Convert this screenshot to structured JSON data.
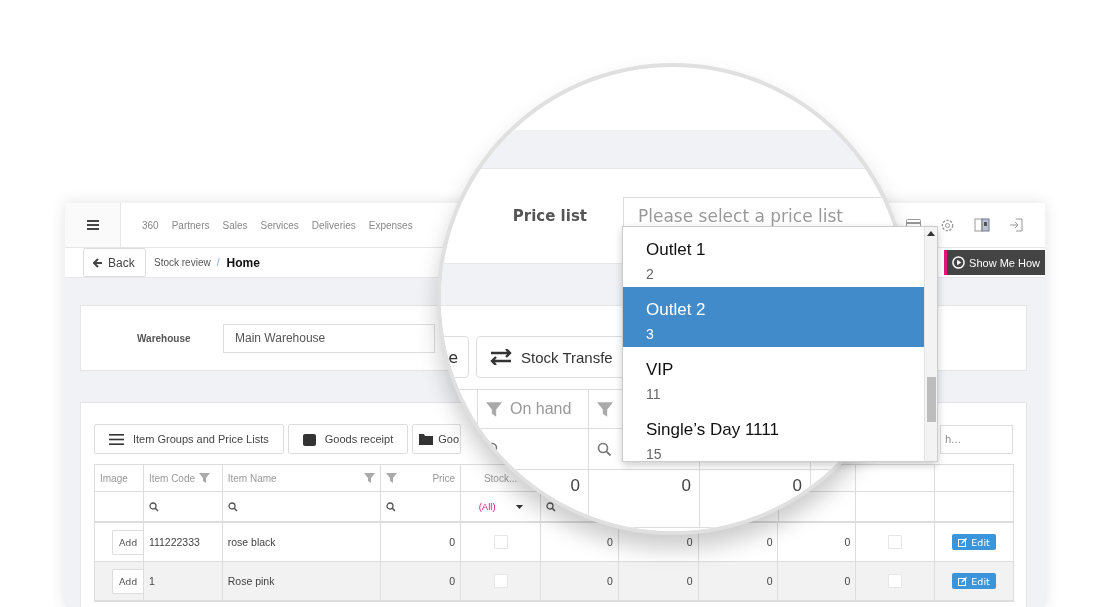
{
  "top_nav": {
    "items": [
      "360",
      "Partners",
      "Sales",
      "Services",
      "Deliveries",
      "Expenses"
    ]
  },
  "breadcrumb": {
    "back": "Back",
    "parent": "Stock review",
    "separator": "/",
    "current": "Home"
  },
  "help_button": "Show Me How",
  "warehouse": {
    "label": "Warehouse",
    "value": "Main Warehouse"
  },
  "toolbar": [
    {
      "label": "Item Groups and Price Lists",
      "kind": "menu"
    },
    {
      "label": "Goods receipt",
      "kind": "box"
    },
    {
      "label": "Goo",
      "kind": "folder"
    }
  ],
  "search": {
    "placeholder": "h..."
  },
  "table": {
    "columns": [
      "Image",
      "Item Code",
      "Item Name",
      "Price",
      "Stock..."
    ],
    "stock_filter": "(All)",
    "rows": [
      {
        "add": "Add",
        "code": "111222333",
        "name": "rose black",
        "price": "0",
        "values": [
          "0",
          "0",
          "0",
          "0"
        ],
        "stock_checked": false,
        "flag_checked": false,
        "highlighted": false,
        "action": "Edit"
      },
      {
        "add": "Add",
        "code": "1",
        "name": "Rose pink",
        "price": "0",
        "values": [
          "0",
          "0",
          "0",
          "0"
        ],
        "stock_checked": false,
        "flag_checked": false,
        "highlighted": true,
        "action": "Edit"
      }
    ]
  },
  "magnifier": {
    "price_list": {
      "label": "Price list",
      "placeholder": "Please select a price list"
    },
    "buttons": [
      "e",
      "Stock Transfe"
    ],
    "column": "On hand",
    "values": [
      "0",
      "0",
      "0"
    ],
    "options": [
      {
        "name": "Outlet 1",
        "count": "2",
        "selected": false
      },
      {
        "name": "Outlet 2",
        "count": "3",
        "selected": true
      },
      {
        "name": "VIP",
        "count": "11",
        "selected": false
      },
      {
        "name": "Single’s Day 1111",
        "count": "15",
        "selected": false
      }
    ]
  }
}
